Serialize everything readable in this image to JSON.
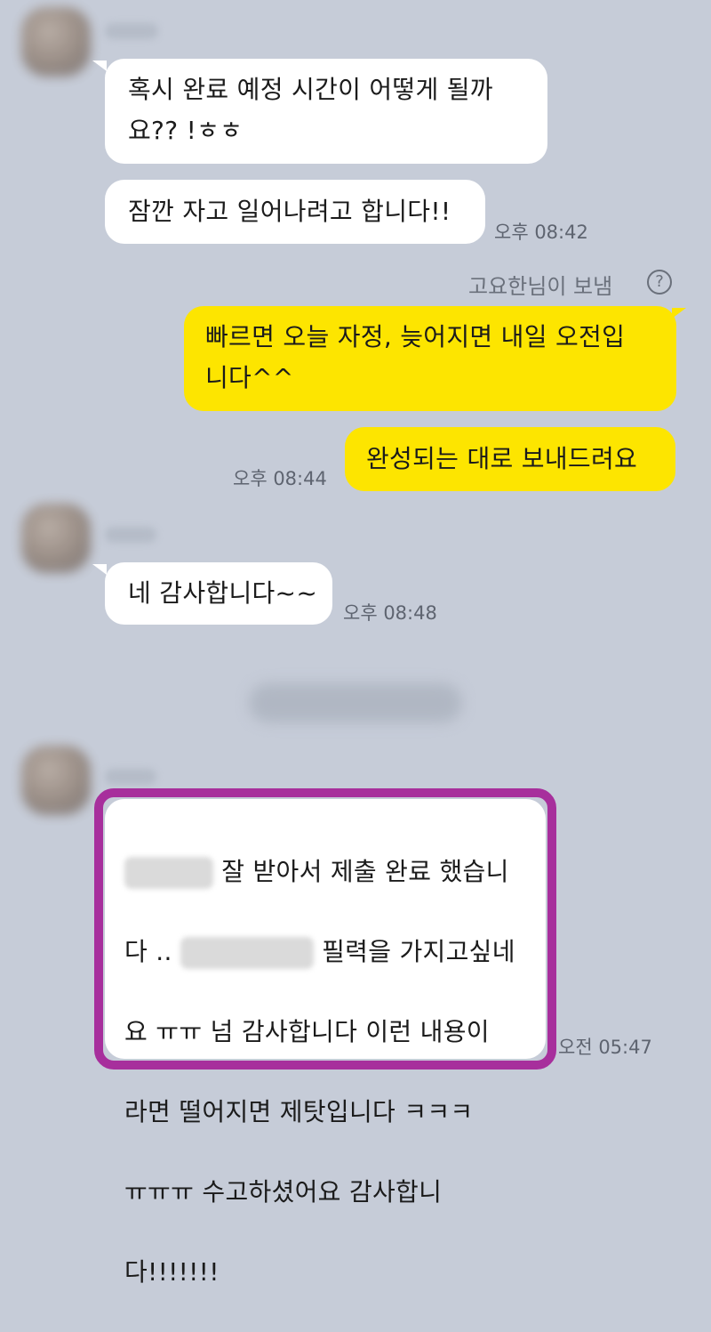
{
  "messages": {
    "m1": {
      "text": "혹시 완료 예정 시간이 어떻게 될까\n요?? !ㅎㅎ"
    },
    "m2": {
      "text": "잠깐 자고 일어나려고 합니다!!",
      "time": "오후 08:42"
    },
    "sent_note": {
      "text": "고요한님이 보냄",
      "icon": "question-circle-icon"
    },
    "m3": {
      "text": "빠르면 오늘 자정, 늦어지면 내일 오전입\n니다^^"
    },
    "m4": {
      "text": "완성되는 대로 보내드려요",
      "time": "오후 08:44"
    },
    "m5": {
      "text": "네 감사합니다~~",
      "time": "오후 08:48"
    },
    "m6": {
      "line1": "잘 받아서 제출 완료 했습니",
      "line2_a": "다 ..",
      "line2_b": "필력을 가지고싶네",
      "line3": "요 ㅠㅠ 넘 감사합니다 이런 내용이",
      "line4": "라면 떨어지면 제탓입니다 ㅋㅋㅋ",
      "line5": "ㅠㅠㅠ 수고하셨어요 감사합니",
      "line6": "다!!!!!!!",
      "time": "오전 05:47"
    }
  },
  "colors": {
    "background": "#c6ccd8",
    "incoming_bubble": "#ffffff",
    "outgoing_bubble": "#fde500",
    "highlight_border": "#a72f9c"
  }
}
